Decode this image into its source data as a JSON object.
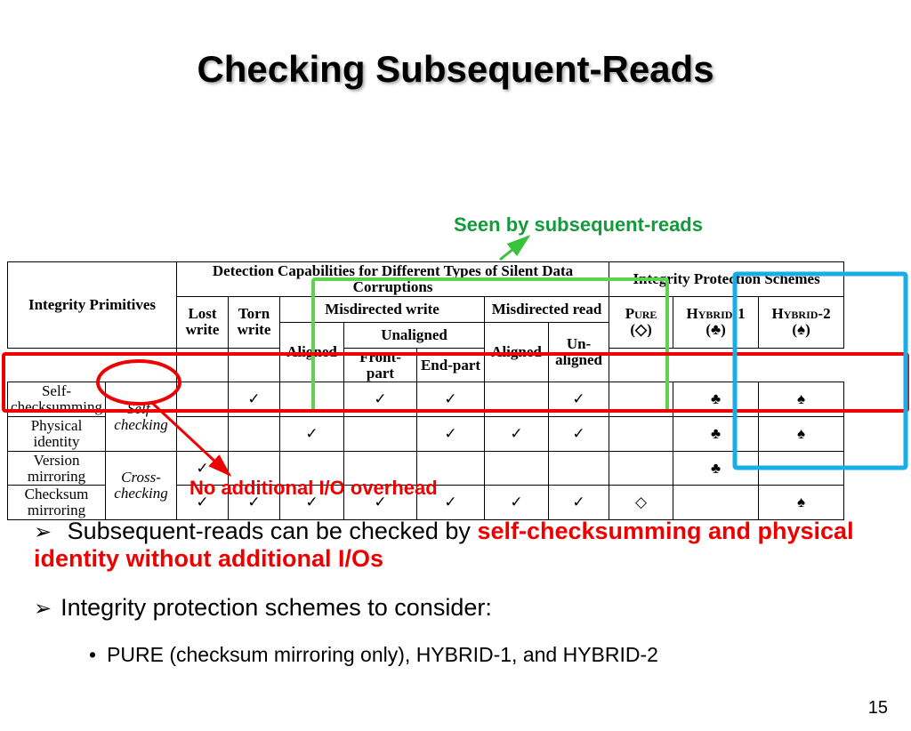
{
  "title": "Checking Subsequent-Reads",
  "annot_green": "Seen by subsequent-reads",
  "annot_red": "No additional I/O overhead",
  "page_num": "15",
  "table": {
    "hdr_primitives": "Integrity Primitives",
    "hdr_detection": "Detection Capabilities for Different Types of Silent Data Corruptions",
    "hdr_schemes": "Integrity Protection Schemes",
    "col_lost": "Lost write",
    "col_torn": "Torn write",
    "col_misdir_w": "Misdirected write",
    "col_aligned": "Aligned",
    "col_unaligned_grp": "Unaligned",
    "col_front": "Front-part",
    "col_end": "End-part",
    "col_misdir_r": "Misdirected read",
    "col_unaligned2": "Un-aligned",
    "col_pure": "Pure",
    "col_pure_sym": "(◇)",
    "col_h1": "Hybrid-1",
    "col_h1_sym": "(♣)",
    "col_h2": "Hybrid-2",
    "col_h2_sym": "(♠)",
    "rows": [
      {
        "name": "Self-checksumming",
        "group": "Self-checking",
        "cells": [
          "",
          "✓",
          "",
          "✓",
          "✓",
          "",
          "✓",
          "",
          "♣",
          "♠"
        ]
      },
      {
        "name": "Physical identity",
        "group": "",
        "cells": [
          "",
          "",
          "✓",
          "",
          "✓",
          "✓",
          "✓",
          "",
          "♣",
          "♠"
        ]
      },
      {
        "name": "Version mirroring",
        "group": "Cross-checking",
        "cells": [
          "✓",
          "",
          "",
          "",
          "",
          "",
          "",
          "",
          "♣",
          ""
        ]
      },
      {
        "name": "Checksum mirroring",
        "group": "",
        "cells": [
          "✓",
          "✓",
          "✓",
          "✓",
          "✓",
          "✓",
          "✓",
          "◇",
          "",
          "♠"
        ]
      }
    ]
  },
  "bullets": {
    "b1_a": "Subsequent-reads can be checked by ",
    "b1_b": "self-checksumming and physical identity without additional I/Os",
    "b2": "Integrity protection schemes to consider:",
    "b2_sub": "PURE (checksum mirroring only), HYBRID-1, and HYBRID-2"
  }
}
